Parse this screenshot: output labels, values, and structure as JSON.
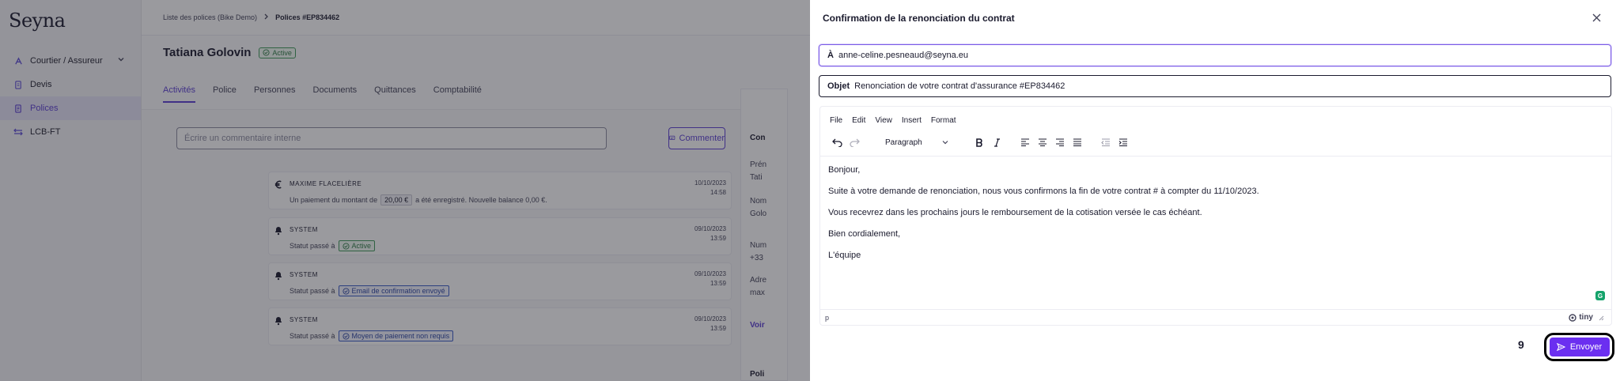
{
  "sidebar": {
    "logo": "Seyna",
    "items": [
      {
        "label": "Courtier / Assureur",
        "icon": "broker-icon"
      },
      {
        "label": "Devis",
        "icon": "document-icon"
      },
      {
        "label": "Polices",
        "icon": "policy-icon"
      },
      {
        "label": "LCB-FT",
        "icon": "compliance-icon"
      }
    ]
  },
  "breadcrumb": {
    "parent": "Liste des polices (Bike Demo)",
    "current": "Polices #EP834462"
  },
  "policy": {
    "holder": "Tatiana Golovin",
    "status": "Active"
  },
  "tabs": [
    "Activités",
    "Police",
    "Personnes",
    "Documents",
    "Quittances",
    "Comptabilité"
  ],
  "comment": {
    "placeholder": "Écrire un commentaire interne",
    "button": "Commenter"
  },
  "activities": [
    {
      "author": "MAXIME FLACELIÈRE",
      "date": "10/10/2023",
      "time": "14:58",
      "msg_pre": "Un paiement du montant de",
      "amount": "20,00 €",
      "msg_post": "a été enregistré. Nouvelle balance 0,00 €."
    },
    {
      "author": "SYSTEM",
      "date": "09/10/2023",
      "time": "13:59",
      "msg_pre": "Statut passé à",
      "status": "Active"
    },
    {
      "author": "SYSTEM",
      "date": "09/10/2023",
      "time": "13:59",
      "msg_pre": "Statut passé à",
      "status": "Email de confirmation envoyé"
    },
    {
      "author": "SYSTEM",
      "date": "09/10/2023",
      "time": "13:59",
      "msg_pre": "Statut passé à",
      "status": "Moyen de paiement non requis"
    }
  ],
  "right_panel": {
    "lines": [
      "Con",
      "Prén",
      "Tati",
      "Nom",
      "Golo",
      "Num",
      "+33",
      "Adre",
      "max",
      "Voir",
      "Poli"
    ]
  },
  "modal": {
    "title": "Confirmation de la renonciation du contrat",
    "to_label": "À",
    "to_value": "anne-celine.pesneaud@seyna.eu",
    "subject_label": "Objet",
    "subject_value": "Renonciation de votre contrat d'assurance #EP834462",
    "menu": [
      "File",
      "Edit",
      "View",
      "Insert",
      "Format"
    ],
    "format_select": "Paragraph",
    "body": [
      "Bonjour,",
      "Suite à votre demande de renonciation, nous vous confirmons la fin de votre contrat # à compter du 11/10/2023.",
      "Vous recevrez dans les prochains jours le remboursement de la cotisation versée le cas échéant.",
      "Bien cordialement,",
      "L'équipe"
    ],
    "status_path": "p",
    "brand": "tiny",
    "step": "9",
    "send": "Envoyer"
  }
}
